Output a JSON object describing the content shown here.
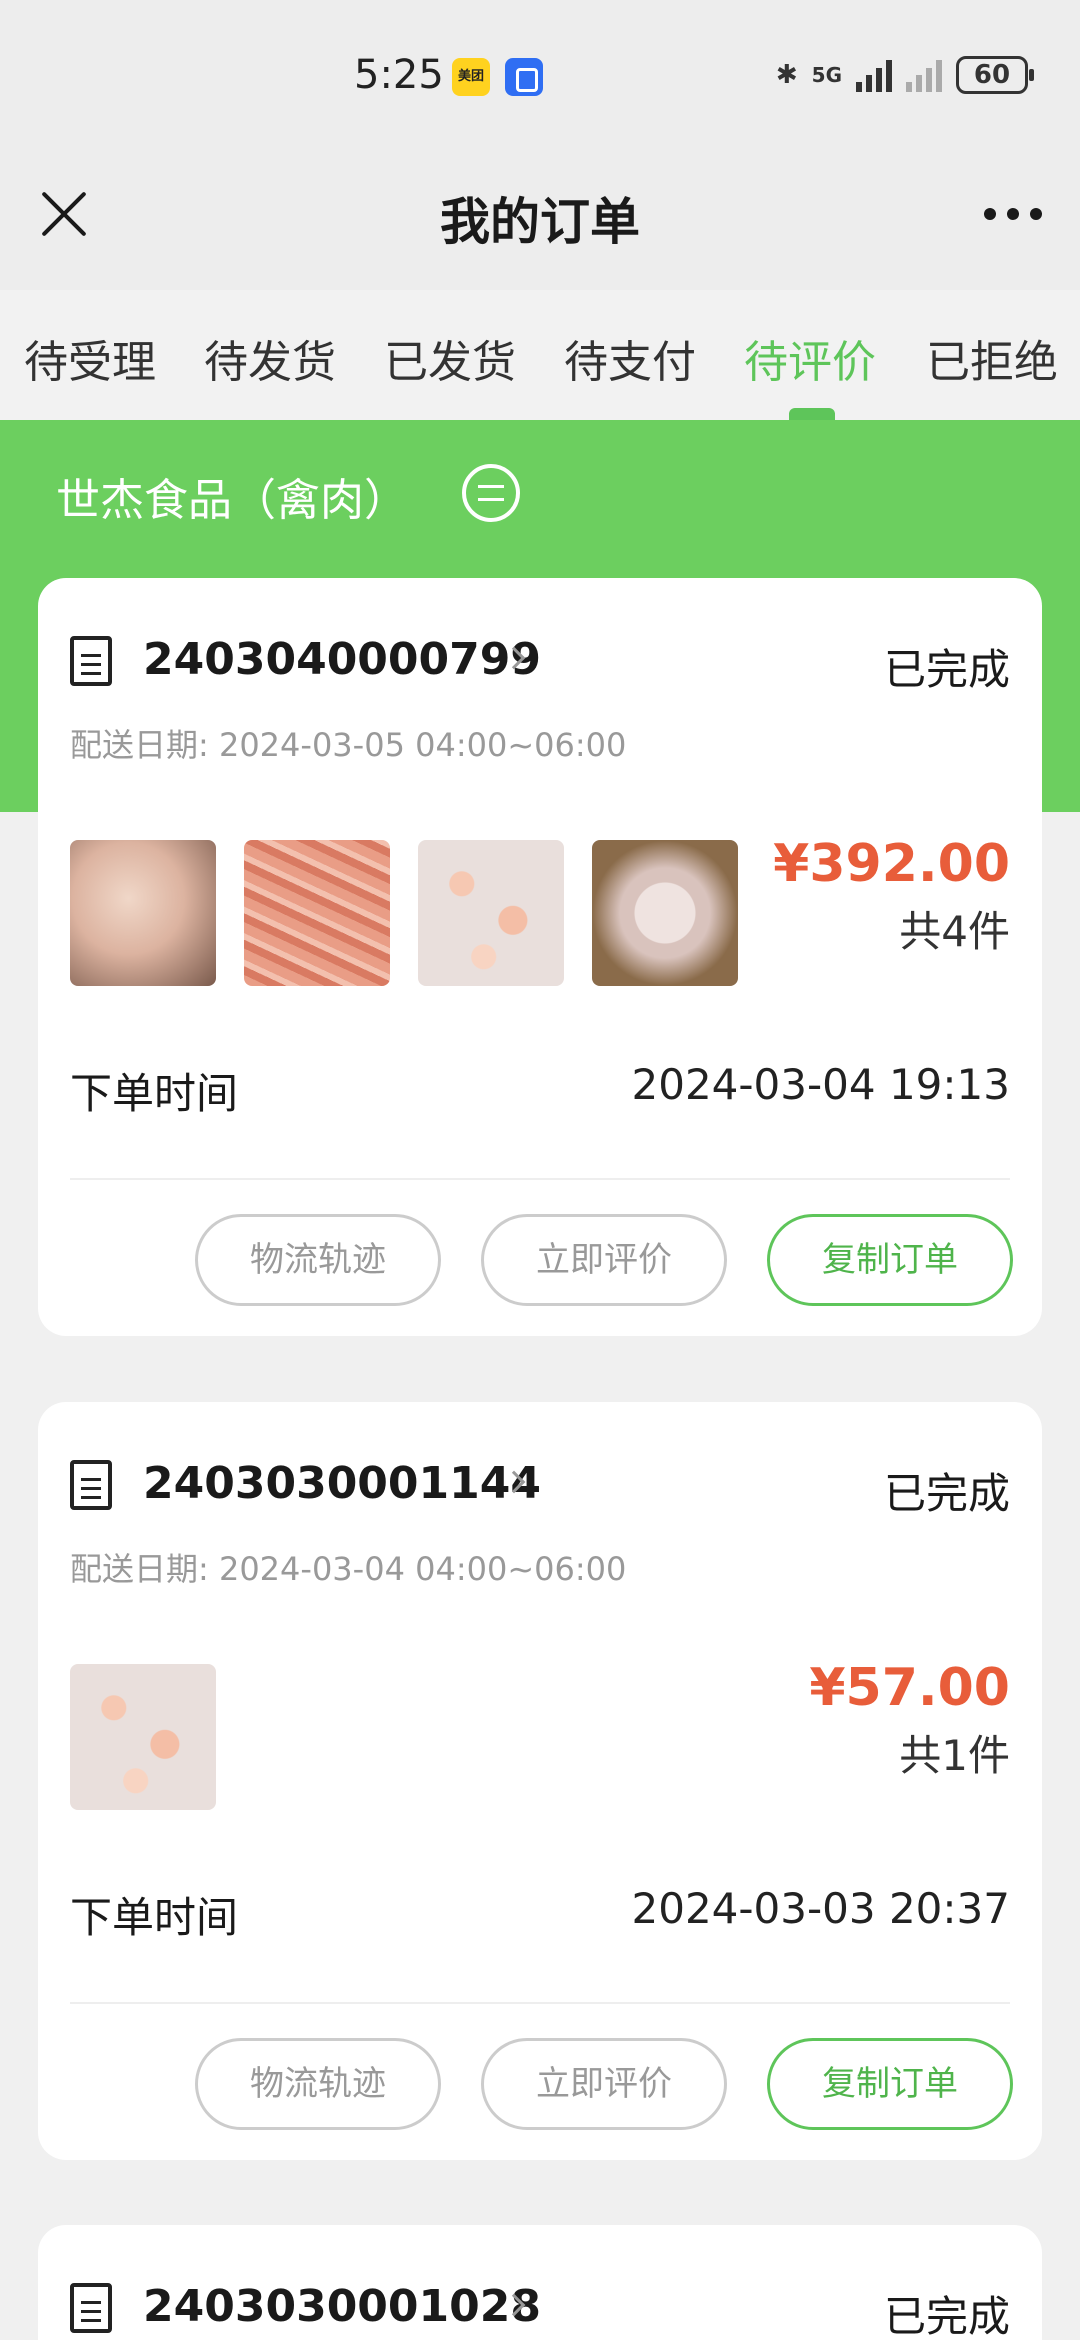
{
  "status_bar": {
    "time": "5:25",
    "app_badge": "美团",
    "network": "5G",
    "battery": "60"
  },
  "header": {
    "title": "我的订单"
  },
  "tabs": [
    {
      "label": "待受理"
    },
    {
      "label": "待发货"
    },
    {
      "label": "已发货"
    },
    {
      "label": "待支付"
    },
    {
      "label": "待评价",
      "active": true
    },
    {
      "label": "已拒绝"
    }
  ],
  "shop": {
    "name": "世杰食品（禽肉）"
  },
  "orders": [
    {
      "order_no": "2403040000799",
      "status": "已完成",
      "delivery": "配送日期:  2024-03-05 04:00~06:00",
      "price": "¥392.00",
      "count": "共4件",
      "time_label": "下单时间",
      "time": "2024-03-04 19:13",
      "thumbnails": [
        "chicken-legs",
        "shredded-chicken",
        "diced-chicken",
        "chicken-pieces"
      ],
      "buttons": {
        "logistics": "物流轨迹",
        "review": "立即评价",
        "copy": "复制订单"
      }
    },
    {
      "order_no": "2403030001144",
      "status": "已完成",
      "delivery": "配送日期:  2024-03-04 04:00~06:00",
      "price": "¥57.00",
      "count": "共1件",
      "time_label": "下单时间",
      "time": "2024-03-03 20:37",
      "thumbnails": [
        "diced-chicken"
      ],
      "buttons": {
        "logistics": "物流轨迹",
        "review": "立即评价",
        "copy": "复制订单"
      }
    },
    {
      "order_no": "2403030001028",
      "status": "已完成"
    }
  ],
  "colors": {
    "accent": "#5ec55a",
    "banner": "#6ccf5f",
    "price": "#e85d3a"
  }
}
